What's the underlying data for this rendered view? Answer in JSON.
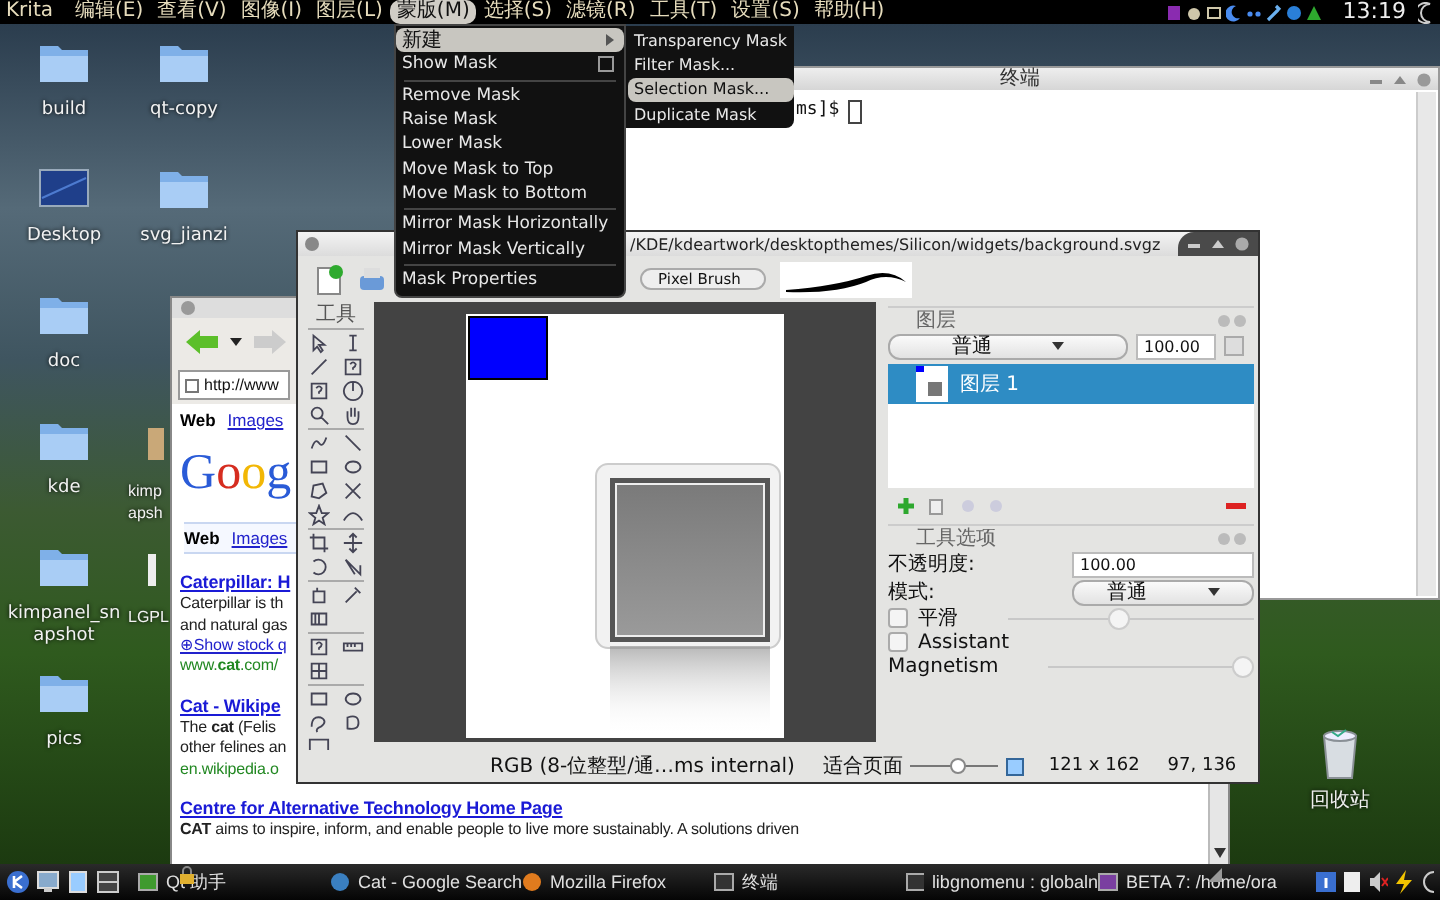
{
  "menubar": {
    "app": "Krita",
    "menus": [
      {
        "label": "编辑(E)",
        "selected": false
      },
      {
        "label": "查看(V)",
        "selected": false
      },
      {
        "label": "图像(I)",
        "selected": false
      },
      {
        "label": "图层(L)",
        "selected": false
      },
      {
        "label": "蒙版(M)",
        "selected": true
      },
      {
        "label": "选择(S)",
        "selected": false
      },
      {
        "label": "滤镜(R)",
        "selected": false
      },
      {
        "label": "工具(T)",
        "selected": false
      },
      {
        "label": "设置(S)",
        "selected": false
      },
      {
        "label": "帮助(H)",
        "selected": false
      }
    ],
    "clock": "13:19"
  },
  "mask_menu": {
    "items": [
      {
        "kind": "submenu",
        "label": "新建",
        "selected": true
      },
      {
        "kind": "check",
        "label": "Show Mask",
        "checked": false,
        "selected": false
      },
      {
        "kind": "separator"
      },
      {
        "kind": "action",
        "label": "Remove Mask",
        "selected": false
      },
      {
        "kind": "action",
        "label": "Raise Mask",
        "selected": false
      },
      {
        "kind": "action",
        "label": "Lower Mask",
        "selected": false
      },
      {
        "kind": "action",
        "label": "Move Mask to Top",
        "selected": false
      },
      {
        "kind": "action",
        "label": "Move Mask to Bottom",
        "selected": false
      },
      {
        "kind": "separator"
      },
      {
        "kind": "action",
        "label": "Mirror Mask Horizontally",
        "selected": false
      },
      {
        "kind": "action",
        "label": "Mirror Mask Vertically",
        "selected": false
      },
      {
        "kind": "separator"
      },
      {
        "kind": "action",
        "label": "Mask Properties",
        "selected": false
      }
    ]
  },
  "new_submenu": {
    "items": [
      {
        "label": "Transparency Mask",
        "selected": false
      },
      {
        "label": "Filter Mask...",
        "selected": false
      },
      {
        "label": "Selection Mask...",
        "selected": true
      },
      {
        "label": "Duplicate Mask",
        "selected": false
      }
    ]
  },
  "desktop_icons": [
    {
      "label": "build",
      "kind": "folder"
    },
    {
      "label": "Desktop",
      "kind": "screen"
    },
    {
      "label": "doc",
      "kind": "folder"
    },
    {
      "label": "kde",
      "kind": "folder"
    },
    {
      "label": "kimpanel_snapshot",
      "kind": "folder"
    },
    {
      "label": "pics",
      "kind": "folder"
    },
    {
      "label": "qt-copy",
      "kind": "folder"
    },
    {
      "label": "svg_jianzi",
      "kind": "folder"
    }
  ],
  "partial_icons": [
    {
      "kind": "package",
      "label_lines": [
        "kimp",
        "apsh"
      ]
    },
    {
      "kind": "document",
      "label_lines": [
        "LGPL"
      ]
    }
  ],
  "trash": {
    "label": "回收站"
  },
  "terminal": {
    "title": "终端",
    "prompt": "ms]$"
  },
  "browser": {
    "url": "http://www",
    "tabs": [
      {
        "label": "Web",
        "selected": true
      },
      {
        "label": "Images",
        "selected": false
      }
    ],
    "logo": "Goog",
    "result_tabs": [
      {
        "label": "Web",
        "selected": true
      },
      {
        "label": "Images",
        "selected": false
      }
    ],
    "results": [
      {
        "title": "Caterpillar: H",
        "lines": [
          "Caterpillar is th",
          "and natural gas"
        ],
        "more_link": "⊕Show stock q",
        "url": "www.**cat**.com/"
      },
      {
        "title": "Cat - Wikipe",
        "lines": [
          "The **cat** (Felis",
          "other felines an"
        ],
        "url": "en.wikipedia.o"
      },
      {
        "title": "Centre for Alternative Technology Home Page",
        "lines": [
          "**CAT** aims to inspire, inform, and enable people to live more sustainably. A solutions driven"
        ]
      }
    ]
  },
  "krita": {
    "title": "/KDE/kdeartwork/desktopthemes/Silicon/widgets/background.svgz",
    "brush": "Pixel Brush",
    "toolbox_title": "工具",
    "layers": {
      "title": "图层",
      "blend_mode": "普通",
      "opacity": "100.00",
      "items": [
        {
          "name": "图层 1",
          "selected": true
        }
      ]
    },
    "tool_options": {
      "title": "工具选项",
      "opacity_label": "不透明度:",
      "opacity": "100.00",
      "mode_label": "模式:",
      "mode": "普通",
      "options": [
        {
          "kind": "check_slider",
          "label": "平滑",
          "checked": false,
          "level": 0.45
        },
        {
          "kind": "check",
          "label": "Assistant",
          "checked": false
        },
        {
          "kind": "slider",
          "label": "Magnetism",
          "level": 1
        }
      ]
    },
    "status": {
      "color_model": "RGB (8-位整型/通…ms internal)",
      "zoom": {
        "label": "适合页面",
        "level": 0.55
      },
      "size": "121 x 162",
      "cursor": "97, 136"
    }
  },
  "taskbar": {
    "tasks": [
      {
        "kind": "qt",
        "label": "Qt 助手"
      },
      {
        "kind": "globe",
        "label": "Cat - Google Search"
      },
      {
        "kind": "firefox",
        "label": "Mozilla Firefox"
      },
      {
        "kind": "terminal",
        "label": "终端"
      },
      {
        "kind": "terminal",
        "label": "libgnomenu : globaln"
      },
      {
        "kind": "krita",
        "label": "BETA 7: /home/ora"
      }
    ]
  }
}
